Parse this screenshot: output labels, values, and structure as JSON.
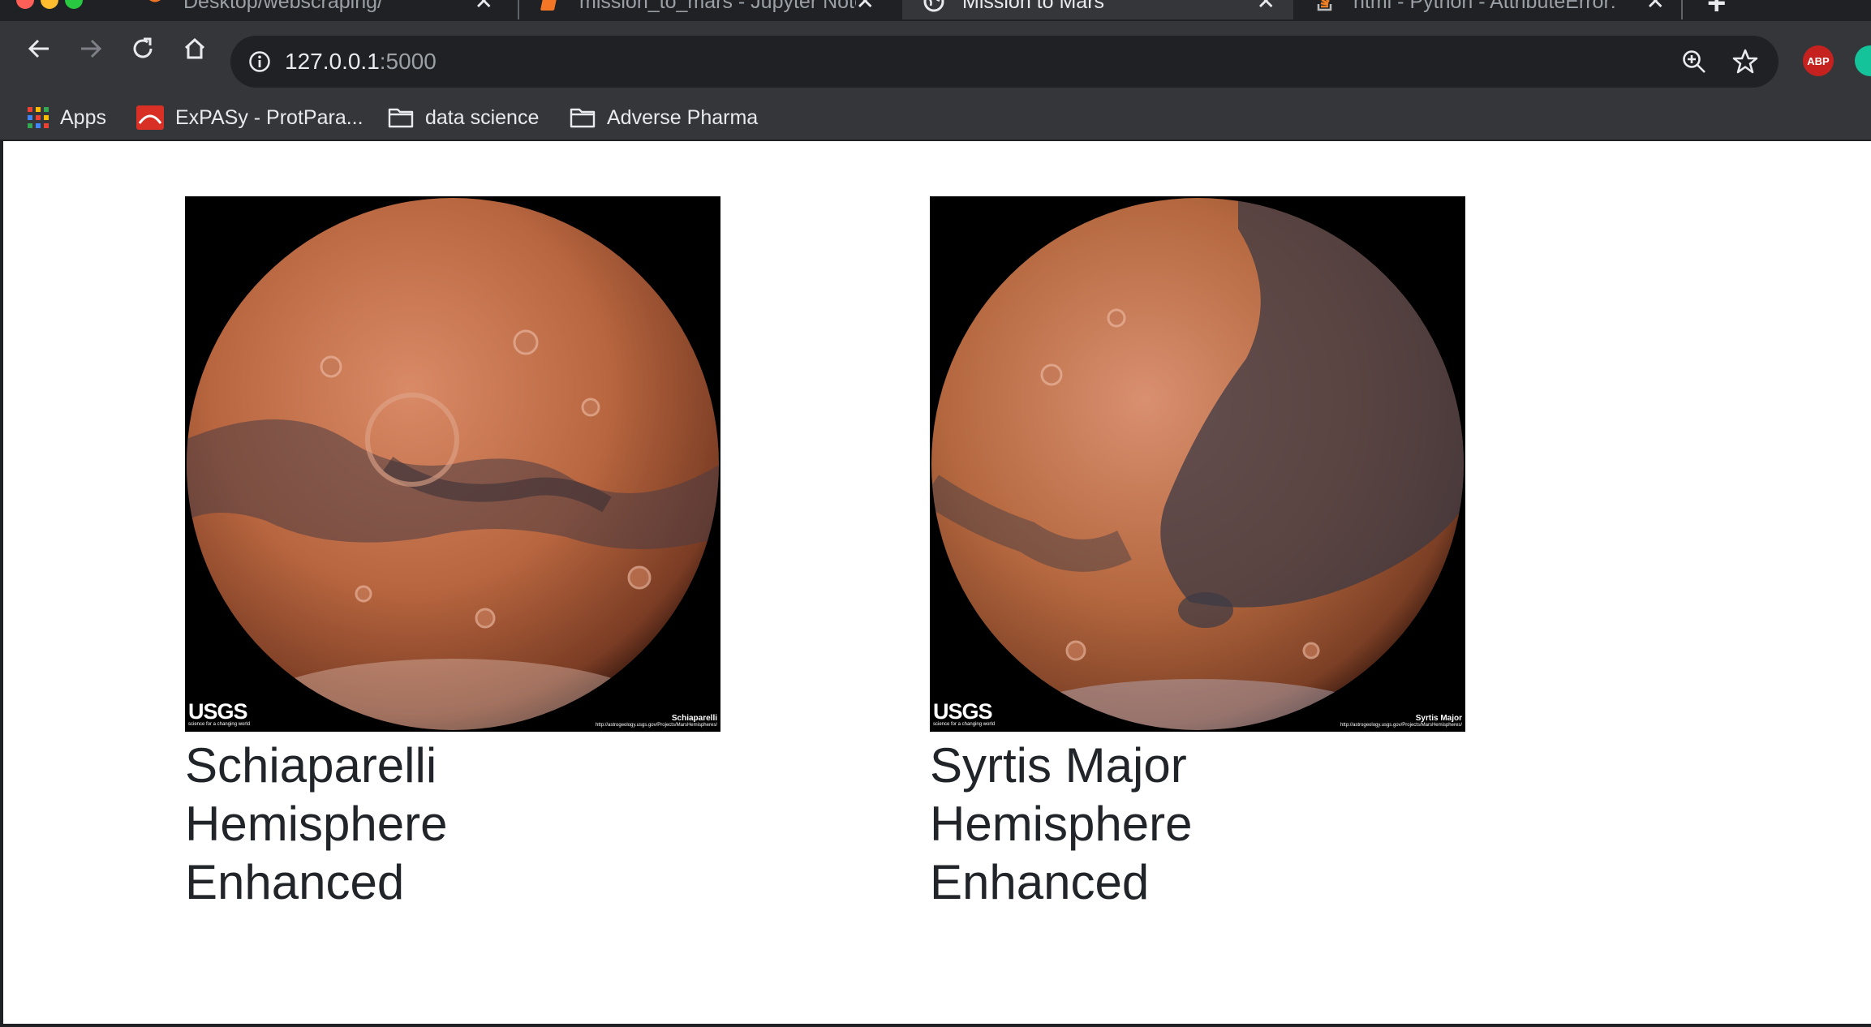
{
  "browser": {
    "tabs": [
      {
        "title": "Desktop/webscraping/",
        "active": false
      },
      {
        "title": "mission_to_mars - Jupyter Noteb",
        "active": false
      },
      {
        "title": "Mission to Mars",
        "active": true
      },
      {
        "title": "html - Python - AttributeError: '",
        "active": false
      }
    ],
    "url_host": "127.0.0.1",
    "url_port": ":5000",
    "extensions": {
      "abp_label": "ABP"
    }
  },
  "bookmarks": [
    {
      "label": "Apps"
    },
    {
      "label": "ExPASy - ProtPara..."
    },
    {
      "label": "data science"
    },
    {
      "label": "Adverse Pharma"
    }
  ],
  "hemispheres": [
    {
      "title": "Schiaparelli Hemisphere Enhanced",
      "image_caption": "Schiaparelli",
      "image_credit": "http://astrogeology.usgs.gov/Projects/MarsHemispheres/",
      "logo_text": "USGS",
      "logo_tagline": "science for a changing world"
    },
    {
      "title": "Syrtis Major Hemisphere Enhanced",
      "image_caption": "Syrtis Major",
      "image_credit": "http://astrogeology.usgs.gov/Projects/MarsHemispheres/",
      "logo_text": "USGS",
      "logo_tagline": "science for a changing world"
    }
  ],
  "colors": {
    "chrome_dark": "#202124",
    "chrome_toolbar": "#35363a",
    "mars_light": "#d98a66",
    "mars_mid": "#b0603e",
    "mars_dark": "#3c3a44"
  }
}
